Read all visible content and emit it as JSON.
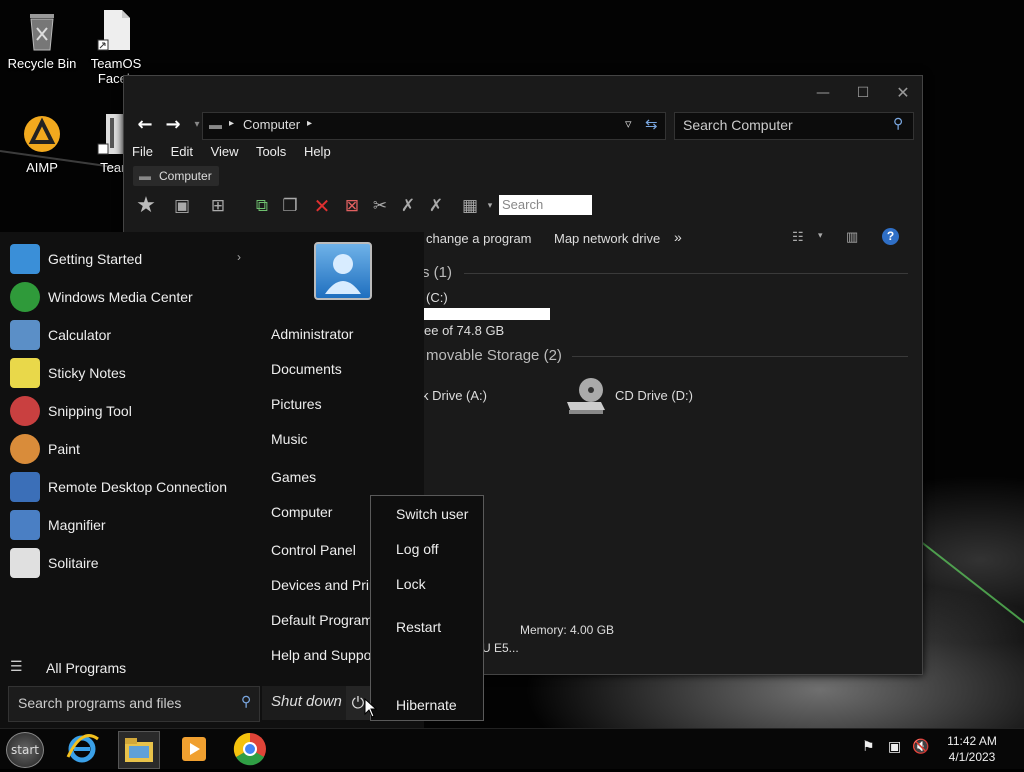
{
  "desktop": {
    "icons": [
      {
        "label": "Recycle Bin"
      },
      {
        "label": "TeamOS\nFaceb"
      },
      {
        "label": "AIMP"
      },
      {
        "label": "Team"
      }
    ]
  },
  "explorer": {
    "address": {
      "segment": "Computer",
      "arrow": "▸"
    },
    "search_placeholder": "Search Computer",
    "menu": [
      "File",
      "Edit",
      "View",
      "Tools",
      "Help"
    ],
    "crumb_tab": "Computer",
    "toolbar_search": "Search",
    "commands": {
      "change_program": "change a program",
      "map_drive": "Map network drive",
      "more": "»"
    },
    "groups": {
      "hard_disks": "s (1)",
      "c_drive": "(C:)",
      "free_space": "ee of 74.8 GB",
      "removable": "movable Storage (2)",
      "floppy": "k Drive (A:)",
      "cd": "CD Drive (D:)"
    },
    "details": {
      "memory": "Memory: 4.00 GB",
      "cpu": "U E5..."
    }
  },
  "start_menu": {
    "programs": [
      {
        "label": "Getting Started",
        "icon": "getting-started",
        "color": "#3a8fd8",
        "has_arrow": true
      },
      {
        "label": "Windows Media Center",
        "icon": "media-center",
        "color": "#2f9a3a"
      },
      {
        "label": "Calculator",
        "icon": "calculator",
        "color": "#5b8fc7"
      },
      {
        "label": "Sticky Notes",
        "icon": "sticky-notes",
        "color": "#e9d84a"
      },
      {
        "label": "Snipping Tool",
        "icon": "snipping-tool",
        "color": "#c94040"
      },
      {
        "label": "Paint",
        "icon": "paint",
        "color": "#d98c3a"
      },
      {
        "label": "Remote Desktop Connection",
        "icon": "remote-desktop",
        "color": "#3b6fb8"
      },
      {
        "label": "Magnifier",
        "icon": "magnifier",
        "color": "#4a7fc4"
      },
      {
        "label": "Solitaire",
        "icon": "solitaire",
        "color": "#e0e0e0"
      }
    ],
    "all_programs": "All Programs",
    "right": [
      "Administrator",
      "Documents",
      "Pictures",
      "Music",
      "Games",
      "Computer",
      "Control Panel",
      "Devices and Print",
      "Default Programs",
      "Help and Support"
    ],
    "search_placeholder": "Search programs and files",
    "shutdown_label": "Shut down"
  },
  "shutdown_menu": [
    "Switch user",
    "Log off",
    "Lock",
    "Restart",
    "Hibernate"
  ],
  "taskbar": {
    "start": "start",
    "time": "11:42 AM",
    "date": "4/1/2023"
  }
}
